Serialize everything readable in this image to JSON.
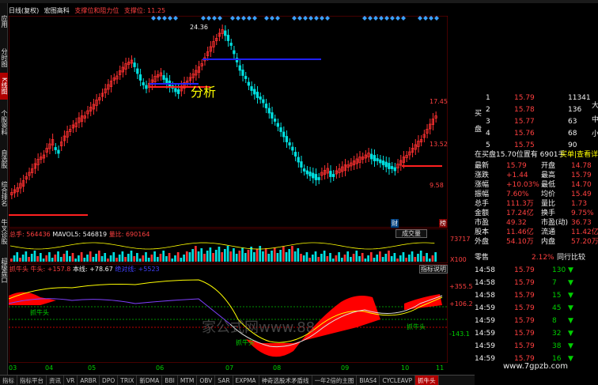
{
  "sidebar": {
    "items": [
      {
        "label": "应用",
        "active": false
      },
      {
        "label": "分时图",
        "active": false
      },
      {
        "label": "K线图",
        "active": true
      },
      {
        "label": "个股资料",
        "active": false
      },
      {
        "label": "自选股",
        "active": false
      },
      {
        "label": "综合排名",
        "active": false
      },
      {
        "label": "牛叉诊股",
        "active": false
      },
      {
        "label": "超级盘口",
        "active": false
      }
    ]
  },
  "header": {
    "period": "日线(复权)",
    "name": "宏图高科",
    "ind1": "支撑位和阻力位",
    "ind2": "支撑位: 11.25"
  },
  "main_chart": {
    "price_labels": [
      "17.45",
      "13.52",
      "9.58"
    ],
    "high_label": "24.36",
    "annotation": "分析",
    "markers": [
      "财",
      "榜"
    ],
    "colors": {
      "up": "#ff3030",
      "down": "#00e0e0",
      "support": "#ff2020",
      "resist": "#2020ff"
    }
  },
  "vol_chart": {
    "total_label": "总手: 564436",
    "mavol_label": "MAVOL5: 546819",
    "ratio_label": "量比: 690164",
    "button": "成交量",
    "scale_labels": [
      "73717",
      "X100"
    ]
  },
  "ind_chart": {
    "title": "抓牛头",
    "l1": "牛头: +157.8",
    "l2": "本线: +78.67",
    "l3": "绝对线: +5523",
    "button": "指标说明",
    "scale_labels": [
      "+355.5",
      "+106.2",
      "-143.1"
    ],
    "annot": [
      "抓牛头",
      "抓牛头",
      "抓牛头"
    ]
  },
  "time_axis": [
    "03",
    "04",
    "05",
    "06",
    "07",
    "08",
    "09",
    "10",
    "11"
  ],
  "tabs": [
    {
      "label": "指标",
      "active": false
    },
    {
      "label": "指标平台",
      "active": false
    },
    {
      "label": "资讯",
      "active": false
    },
    {
      "label": "VR",
      "active": false
    },
    {
      "label": "ARBR",
      "active": false
    },
    {
      "label": "DPO",
      "active": false
    },
    {
      "label": "TRIX",
      "active": false
    },
    {
      "label": "新DMA",
      "active": false
    },
    {
      "label": "BBI",
      "active": false
    },
    {
      "label": "MTM",
      "active": false
    },
    {
      "label": "OBV",
      "active": false
    },
    {
      "label": "SAR",
      "active": false
    },
    {
      "label": "EXPMA",
      "active": false
    },
    {
      "label": "神奇选股术矛盾线",
      "active": false
    },
    {
      "label": "一年2倍的主图",
      "active": false
    },
    {
      "label": "BIAS4",
      "active": false
    },
    {
      "label": "CYCLEAVP",
      "active": false
    },
    {
      "label": "抓牛头",
      "active": true
    }
  ],
  "quote": {
    "buy_label": "买",
    "book": [
      {
        "lvl": "1",
        "price": "15.79",
        "vol": "11341"
      },
      {
        "lvl": "2",
        "price": "15.78",
        "vol": "136"
      },
      {
        "lvl": "3",
        "price": "15.77",
        "vol": "63"
      },
      {
        "lvl": "4",
        "price": "15.76",
        "vol": "68"
      },
      {
        "lvl": "5",
        "price": "15.75",
        "vol": "90"
      }
    ],
    "side_labels": [
      "买",
      "盘"
    ],
    "right_labels": [
      "大",
      "中",
      "小"
    ],
    "summary_line": "在买盘15.70位置有 6901手",
    "summary_btn": "买单|查看详单",
    "stats": [
      {
        "k1": "最新",
        "v1": "15.79",
        "k2": "开盘",
        "v2": "14.78"
      },
      {
        "k1": "涨跌",
        "v1": "+1.44",
        "k2": "最高",
        "v2": "15.79"
      },
      {
        "k1": "涨幅",
        "v1": "+10.03%",
        "k2": "最低",
        "v2": "14.70"
      },
      {
        "k1": "振幅",
        "v1": "7.60%",
        "k2": "均价",
        "v2": "15.49"
      },
      {
        "k1": "总手",
        "v1": "111.3万",
        "k2": "量比",
        "v2": "1.73"
      },
      {
        "k1": "金额",
        "v1": "17.24亿",
        "k2": "换手",
        "v2": "9.75%"
      },
      {
        "k1": "市盈",
        "v1": "49.32",
        "k2": "市盈(动)",
        "v2": "36.73"
      },
      {
        "k1": "股本",
        "v1": "11.46亿",
        "k2": "流通",
        "v2": "11.42亿"
      },
      {
        "k1": "外盘",
        "v1": "54.10万",
        "k2": "内盘",
        "v2": "57.20万"
      }
    ],
    "sector": "零售",
    "sector_pct": "2.12%",
    "sector_btn": "同行比较",
    "ticks": [
      {
        "t": "14:58",
        "p": "15.79",
        "v": "130",
        "dir": "down"
      },
      {
        "t": "14:58",
        "p": "15.79",
        "v": "7",
        "dir": "down"
      },
      {
        "t": "14:58",
        "p": "15.79",
        "v": "15",
        "dir": "down"
      },
      {
        "t": "14:59",
        "p": "15.79",
        "v": "45",
        "dir": "down"
      },
      {
        "t": "14:59",
        "p": "15.79",
        "v": "8",
        "dir": "down"
      },
      {
        "t": "14:59",
        "p": "15.79",
        "v": "32",
        "dir": "down"
      },
      {
        "t": "14:59",
        "p": "15.79",
        "v": "38",
        "dir": "down"
      },
      {
        "t": "14:59",
        "p": "15.79",
        "v": "16",
        "dir": "down"
      }
    ]
  },
  "watermark": "家公式网www.88",
  "site": "www.7gpzb.com"
}
